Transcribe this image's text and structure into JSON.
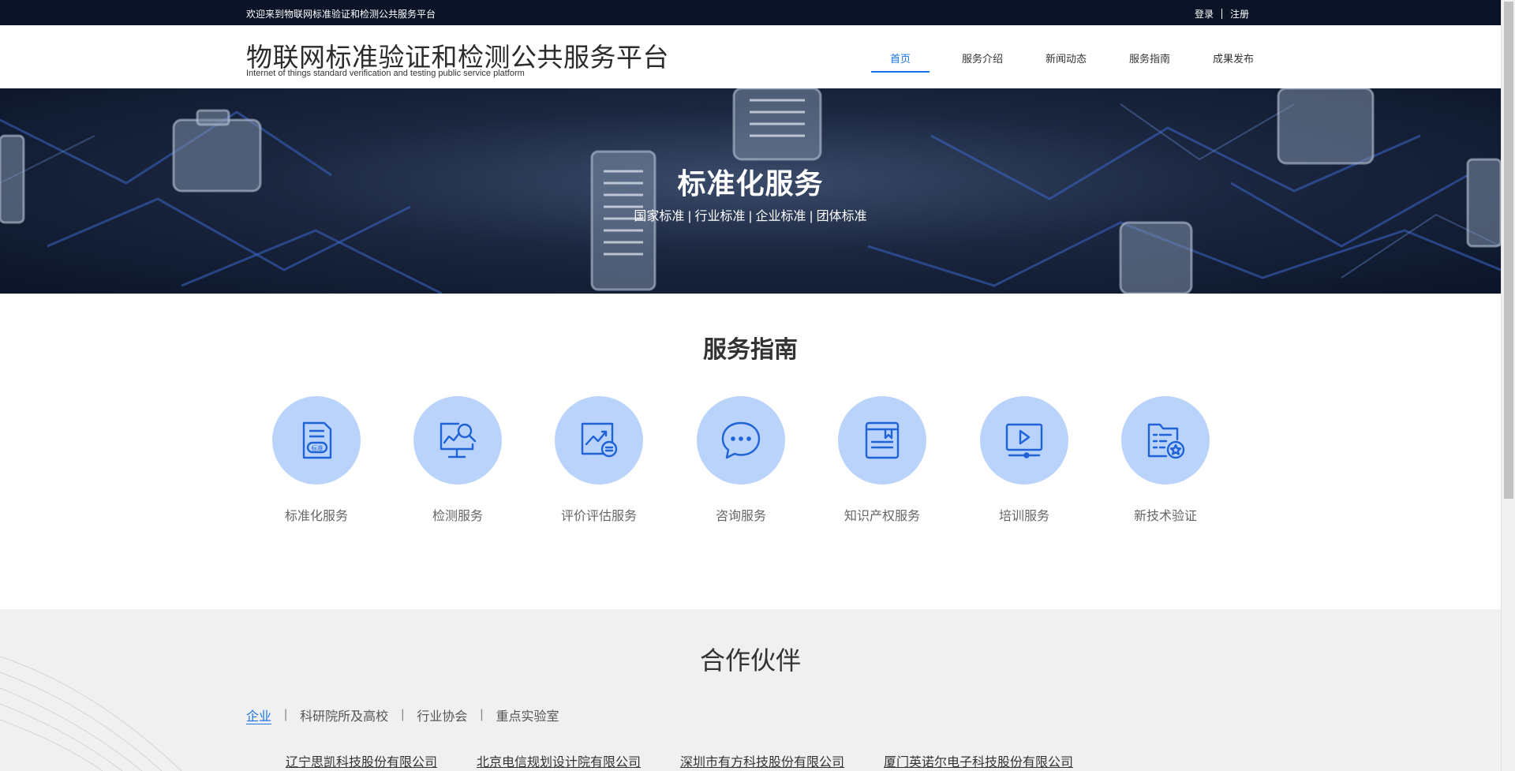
{
  "topbar": {
    "welcome": "欢迎来到物联网标准验证和检测公共服务平台",
    "login": "登录",
    "register": "注册"
  },
  "header": {
    "title": "物联网标准验证和检测公共服务平台",
    "subtitle": "Internet of things standard verification and testing public service platform",
    "nav": [
      {
        "label": "首页",
        "active": true
      },
      {
        "label": "服务介绍",
        "active": false
      },
      {
        "label": "新闻动态",
        "active": false
      },
      {
        "label": "服务指南",
        "active": false
      },
      {
        "label": "成果发布",
        "active": false
      }
    ]
  },
  "banner": {
    "title": "标准化服务",
    "subtitle": "国家标准 | 行业标准 | 企业标准 | 团体标准"
  },
  "services": {
    "title": "服务指南",
    "items": [
      {
        "label": "标准化服务",
        "icon": "standard-document-icon",
        "badge": "标准"
      },
      {
        "label": "检测服务",
        "icon": "monitor-analysis-icon"
      },
      {
        "label": "评价评估服务",
        "icon": "evaluation-chart-icon"
      },
      {
        "label": "咨询服务",
        "icon": "chat-bubble-icon"
      },
      {
        "label": "知识产权服务",
        "icon": "book-icon"
      },
      {
        "label": "培训服务",
        "icon": "video-play-icon"
      },
      {
        "label": "新技术验证",
        "icon": "certified-document-icon"
      }
    ]
  },
  "partners": {
    "title": "合作伙伴",
    "tabs": [
      {
        "label": "企业",
        "active": true
      },
      {
        "label": "科研院所及高校",
        "active": false
      },
      {
        "label": "行业协会",
        "active": false
      },
      {
        "label": "重点实验室",
        "active": false
      }
    ],
    "companies": [
      "辽宁思凯科技股份有限公司",
      "北京电信规划设计院有限公司",
      "深圳市有方科技股份有限公司",
      "厦门英诺尔电子科技股份有限公司"
    ]
  },
  "colors": {
    "accent": "#1a73e8",
    "topbar_bg": "#0b1427",
    "icon_circle": "#b9d3fb",
    "icon_stroke": "#1f63d6",
    "partners_bg": "#f0f0f0"
  }
}
